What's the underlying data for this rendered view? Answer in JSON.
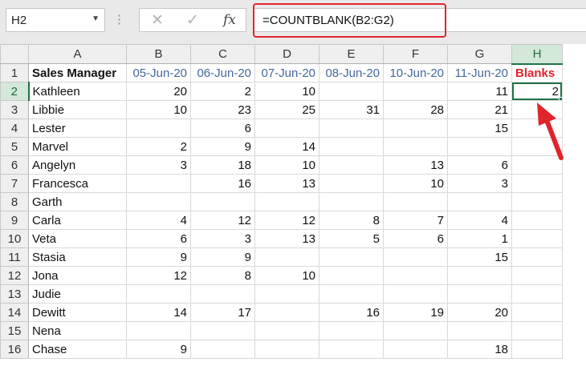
{
  "name_box": {
    "value": "H2"
  },
  "formula_bar": {
    "formula": "=COUNTBLANK(B2:G2)",
    "cancel_icon": "✕",
    "enter_icon": "✓",
    "fx_label": "fx"
  },
  "columns": [
    "A",
    "B",
    "C",
    "D",
    "E",
    "F",
    "G",
    "H"
  ],
  "selected_column": "H",
  "selected_row": 2,
  "colors": {
    "highlight": "#e0242c",
    "selection": "#217346",
    "date_header": "#44679a"
  },
  "rows": [
    {
      "num": "1",
      "cells": [
        "Sales Manager",
        "05-Jun-20",
        "06-Jun-20",
        "07-Jun-20",
        "08-Jun-20",
        "10-Jun-20",
        "11-Jun-20",
        "Blanks"
      ]
    },
    {
      "num": "2",
      "cells": [
        "Kathleen",
        "20",
        "2",
        "10",
        "",
        "",
        "11",
        "2"
      ]
    },
    {
      "num": "3",
      "cells": [
        "Libbie",
        "10",
        "23",
        "25",
        "31",
        "28",
        "21",
        ""
      ]
    },
    {
      "num": "4",
      "cells": [
        "Lester",
        "",
        "6",
        "",
        "",
        "",
        "15",
        ""
      ]
    },
    {
      "num": "5",
      "cells": [
        "Marvel",
        "2",
        "9",
        "14",
        "",
        "",
        "",
        ""
      ]
    },
    {
      "num": "6",
      "cells": [
        "Angelyn",
        "3",
        "18",
        "10",
        "",
        "13",
        "6",
        ""
      ]
    },
    {
      "num": "7",
      "cells": [
        "Francesca",
        "",
        "16",
        "13",
        "",
        "10",
        "3",
        ""
      ]
    },
    {
      "num": "8",
      "cells": [
        "Garth",
        "",
        "",
        "",
        "",
        "",
        "",
        ""
      ]
    },
    {
      "num": "9",
      "cells": [
        "Carla",
        "4",
        "12",
        "12",
        "8",
        "7",
        "4",
        ""
      ]
    },
    {
      "num": "10",
      "cells": [
        "Veta",
        "6",
        "3",
        "13",
        "5",
        "6",
        "1",
        ""
      ]
    },
    {
      "num": "11",
      "cells": [
        "Stasia",
        "9",
        "9",
        "",
        "",
        "",
        "15",
        ""
      ]
    },
    {
      "num": "12",
      "cells": [
        "Jona",
        "12",
        "8",
        "10",
        "",
        "",
        "",
        ""
      ]
    },
    {
      "num": "13",
      "cells": [
        "Judie",
        "",
        "",
        "",
        "",
        "",
        "",
        ""
      ]
    },
    {
      "num": "14",
      "cells": [
        "Dewitt",
        "14",
        "17",
        "",
        "16",
        "19",
        "20",
        ""
      ]
    },
    {
      "num": "15",
      "cells": [
        "Nena",
        "",
        "",
        "",
        "",
        "",
        "",
        ""
      ]
    },
    {
      "num": "16",
      "cells": [
        "Chase",
        "9",
        "",
        "",
        "",
        "",
        "18",
        ""
      ]
    }
  ]
}
